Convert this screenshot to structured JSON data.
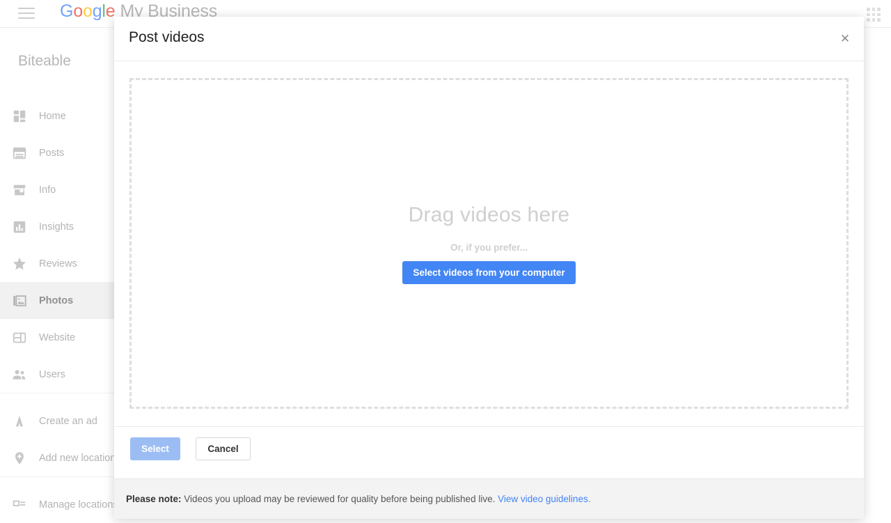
{
  "topbar": {
    "menu_icon": "hamburger-menu-icon",
    "brand_google": [
      "G",
      "o",
      "o",
      "g",
      "l",
      "e"
    ],
    "brand_suffix": "My Business",
    "apps_icon": "apps-grid-icon"
  },
  "business": {
    "name": "Biteable"
  },
  "sidebar": {
    "items": [
      {
        "label": "Home",
        "icon": "dashboard-icon",
        "active": false
      },
      {
        "label": "Posts",
        "icon": "posts-icon",
        "active": false
      },
      {
        "label": "Info",
        "icon": "storefront-icon",
        "active": false
      },
      {
        "label": "Insights",
        "icon": "bar-chart-icon",
        "active": false
      },
      {
        "label": "Reviews",
        "icon": "star-icon",
        "active": false
      },
      {
        "label": "Photos",
        "icon": "photo-library-icon",
        "active": true
      },
      {
        "label": "Website",
        "icon": "web-layout-icon",
        "active": false
      },
      {
        "label": "Users",
        "icon": "people-icon",
        "active": false
      }
    ],
    "secondary_items": [
      {
        "label": "Create an ad",
        "icon": "adwords-icon"
      },
      {
        "label": "Add new location",
        "icon": "add-location-pin-icon"
      }
    ],
    "tertiary_items": [
      {
        "label": "Manage locations",
        "icon": "manage-locations-icon"
      }
    ]
  },
  "modal": {
    "title": "Post videos",
    "close_icon": "close-icon",
    "dropzone": {
      "heading": "Drag videos here",
      "subtext": "Or, if you prefer...",
      "button_label": "Select videos from your computer"
    },
    "actions": {
      "select_label": "Select",
      "cancel_label": "Cancel"
    },
    "note": {
      "lead": "Please note:",
      "body": "Videos you upload may be reviewed for quality before being published live.",
      "link": "View video guidelines."
    }
  },
  "colors": {
    "accent_blue": "#4285F4",
    "disabled_blue": "#9bbdf4",
    "google_blue": "#4285F4",
    "google_red": "#EA4335",
    "google_yellow": "#FBBC05",
    "google_green": "#34A853",
    "dropzone_border": "#dedede",
    "note_background": "#f3f3f3"
  }
}
